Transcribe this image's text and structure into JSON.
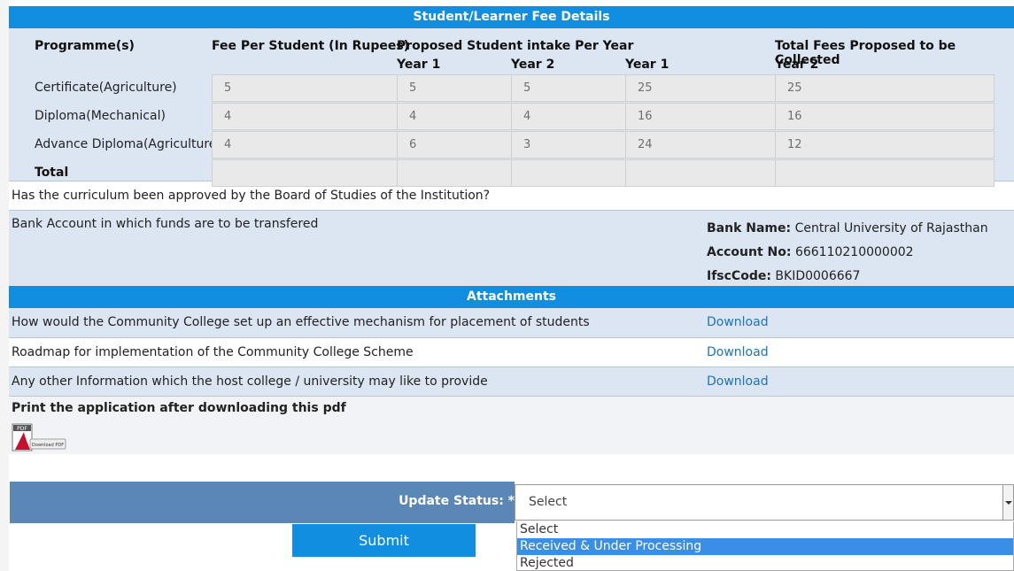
{
  "fee_section": {
    "title": "Student/Learner Fee Details",
    "headers": {
      "programme": "Programme(s)",
      "fee_per_student": "Fee Per Student (In Rupees)",
      "proposed_intake": "Proposed Student intake Per Year",
      "total_fees": "Total Fees Proposed to be Collected",
      "year1_a": "Year 1",
      "year2_a": "Year 2",
      "year1_b": "Year 1",
      "year2_b": "Year 2"
    },
    "rows": [
      {
        "programme": "Certificate(Agriculture)",
        "fee": "5",
        "intake_y1": "5",
        "intake_y2": "5",
        "total_y1": "25",
        "total_y2": "25"
      },
      {
        "programme": "Diploma(Mechanical)",
        "fee": "4",
        "intake_y1": "4",
        "intake_y2": "4",
        "total_y1": "16",
        "total_y2": "16"
      },
      {
        "programme": "Advance Diploma(Agriculture)",
        "fee": "4",
        "intake_y1": "6",
        "intake_y2": "3",
        "total_y1": "24",
        "total_y2": "12"
      }
    ],
    "total_label": "Total"
  },
  "curriculum_question": "Has the curriculum been approved by the Board of Studies of the Institution?",
  "bank": {
    "label": "Bank Account in which funds are to be transfered",
    "bank_name_label": "Bank Name:",
    "bank_name": "Central University of Rajasthan",
    "account_no_label": "Account No:",
    "account_no": "666110210000002",
    "ifsc_label": "IfscCode:",
    "ifsc": "BKID0006667"
  },
  "attachments": {
    "title": "Attachments",
    "items": [
      {
        "label": "How would the Community College set up an effective mechanism for placement of students",
        "link": "Download"
      },
      {
        "label": "Roadmap for implementation of the Community College Scheme",
        "link": "Download"
      },
      {
        "label": "Any other Information which the host college / university may like to provide",
        "link": "Download"
      }
    ]
  },
  "print": {
    "text": "Print the application after downloading this pdf",
    "pdf_badge": "PDF",
    "pdf_button_text": "Download PDF"
  },
  "status": {
    "label": "Update Status: *",
    "selected": "Select",
    "options": [
      "Select",
      "Received & Under Processing",
      "Rejected"
    ],
    "highlighted_index": 1
  },
  "submit_label": "Submit",
  "colors": {
    "accent": "#118ee0",
    "status_bar": "#5b87b7",
    "link": "#1e73be",
    "panel": "#dbe6f2"
  }
}
